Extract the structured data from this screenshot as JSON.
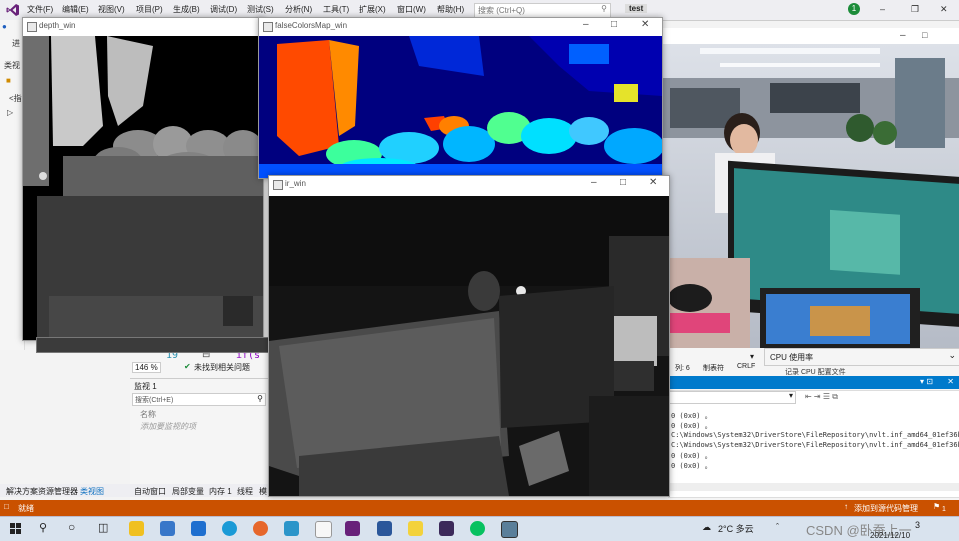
{
  "vs": {
    "menu": [
      "文件(F)",
      "编辑(E)",
      "视图(V)",
      "项目(P)",
      "生成(B)",
      "调试(D)",
      "测试(S)",
      "分析(N)",
      "工具(T)",
      "扩展(X)",
      "窗口(W)",
      "帮助(H)"
    ],
    "search_placeholder": "搜索 (Ctrl+Q)",
    "project_name": "test",
    "notification_count": "1",
    "left_labels": [
      "进",
      "类视",
      "<指"
    ],
    "code_line_number": "19",
    "code_snippet": "if(s",
    "zoom": "146 %",
    "no_issues": "未找到相关问题",
    "watch_title": "监视 1",
    "watch_search": "搜索(Ctrl+E)",
    "watch_col_name": "名称",
    "watch_add": "添加要监视的项",
    "cpu_title": "CPU 使用率",
    "cpu_note": "记录 CPU 配置文件",
    "row_label": "列: 6",
    "tab_label": "制表符",
    "line_ending": "CRLF",
    "output_lines": [
      "0 (0x0) 。",
      "0 (0x0) 。",
      "C:\\Windows\\System32\\DriverStore\\FileRepository\\nvlt.inf_amd64_01ef36b",
      "C:\\Windows\\System32\\DriverStore\\FileRepository\\nvlt.inf_amd64_01ef36b",
      "0 (0x0) 。",
      "0 (0x0) 。"
    ],
    "bottom_tabs": [
      "解决方案资源管理器",
      "类视图",
      "自动窗口",
      "局部变量",
      "内存 1",
      "线程",
      "模"
    ],
    "status_ready": "就绪",
    "status_source_control": "添加到源代码管理",
    "status_badge": "1"
  },
  "windows": {
    "depth_title": "depth_win",
    "false_title": "falseColorsMap_win",
    "ir_title": "ir_win"
  },
  "taskbar": {
    "weather": "2°C 多云",
    "date": "2021/12/10",
    "watermark": "CSDN @卧蚕上一",
    "time_partial": "3"
  },
  "colors": {
    "vs_status": "#ca5100",
    "vs_blue": "#007acc",
    "jet_blue": "#00007f"
  }
}
